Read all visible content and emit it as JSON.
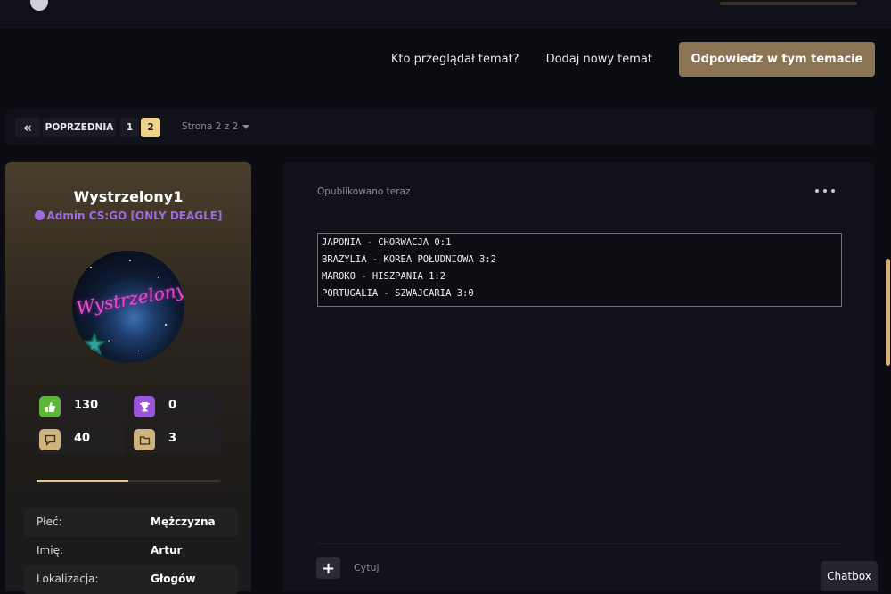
{
  "top_actions": {
    "who_viewed": "Kto przeglądał temat?",
    "new_topic": "Dodaj nowy temat",
    "reply": "Odpowiedz w tym temacie"
  },
  "pagination": {
    "first_icon": "double-chevron-left-icon",
    "first_glyph": "«",
    "prev": "POPRZEDNIA",
    "pages": [
      "1",
      "2"
    ],
    "current_page": "2",
    "page_info": "Strona 2 z 2"
  },
  "author": {
    "name": "Wystrzelony1",
    "group": "Admin CS:GO [ONLY DEAGLE]",
    "avatar_text": "Wystrzelony",
    "stats": [
      {
        "icon": "thumbs-up-icon",
        "value": "130",
        "color": "#5fb43a"
      },
      {
        "icon": "trophy-icon",
        "value": "0",
        "color": "#9a55d9"
      },
      {
        "icon": "comment-icon",
        "value": "40",
        "color": "#cdb37d"
      },
      {
        "icon": "folder-icon",
        "value": "3",
        "color": "#cdb37d"
      }
    ],
    "progress_fraction": 0.5,
    "info": [
      {
        "label": "Płeć:",
        "value": "Mężczyzna"
      },
      {
        "label": "Imię:",
        "value": "Artur"
      },
      {
        "label": "Lokalizacja:",
        "value": "Głogów"
      }
    ]
  },
  "post": {
    "meta": "Opublikowano teraz",
    "code_lines": [
      "JAPONIA - CHORWACJA 0:1",
      "BRAZYLIA - KOREA POŁUDNIOWA 3:2",
      "MAROKO - HISZPANIA 1:2",
      "PORTUGALIA - SZWAJCARIA 3:0"
    ],
    "add_icon": "+",
    "quote": "Cytuj"
  },
  "chatbox": "Chatbox",
  "colors": {
    "accent_gold": "#8a7453",
    "current_page": "#f0d28a",
    "group_purple": "#9c6ce0",
    "background": "#0b0b12"
  }
}
